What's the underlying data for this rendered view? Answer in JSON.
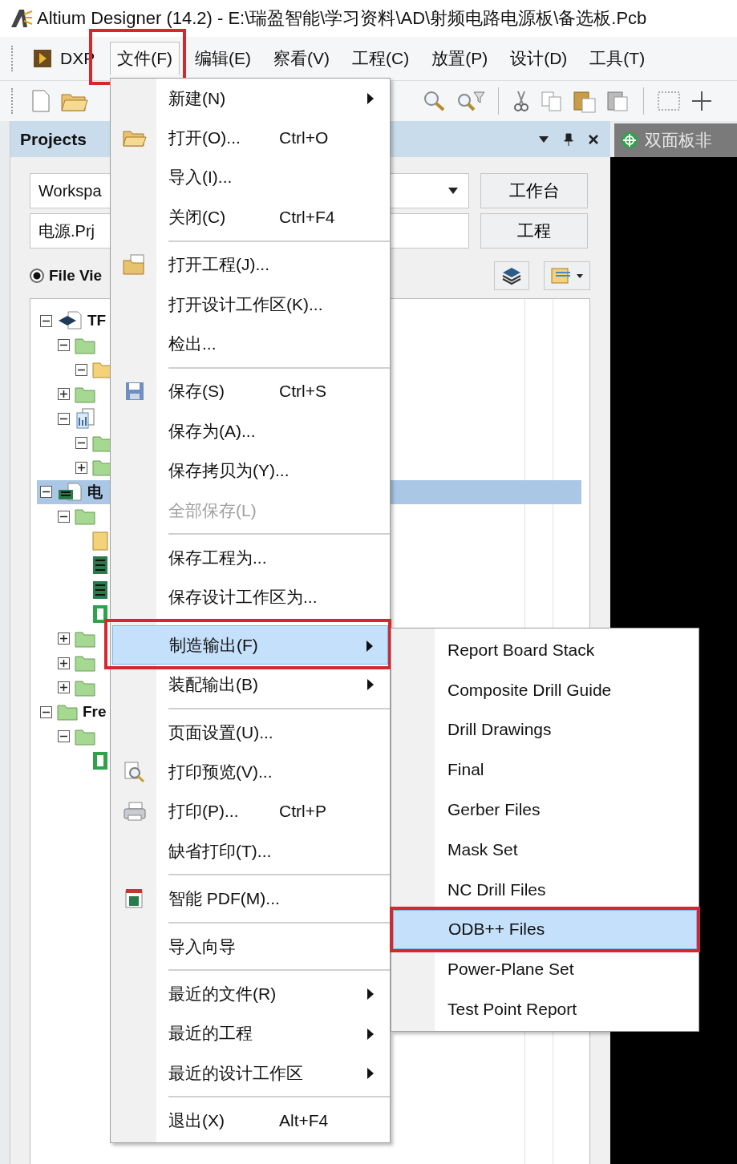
{
  "window": {
    "title": "Altium Designer (14.2) - E:\\瑞盈智能\\学习资料\\AD\\射频电路电源板\\备选板.Pcb"
  },
  "menu_bar": [
    {
      "label": "DXP",
      "selected": false,
      "annotated": false
    },
    {
      "label": "文件(F)",
      "selected": true,
      "annotated": true
    },
    {
      "label": "编辑(E)",
      "selected": false,
      "annotated": false
    },
    {
      "label": "察看(V)",
      "selected": false,
      "annotated": false
    },
    {
      "label": "工程(C)",
      "selected": false,
      "annotated": false
    },
    {
      "label": "放置(P)",
      "selected": false,
      "annotated": false
    },
    {
      "label": "设计(D)",
      "selected": false,
      "annotated": false
    },
    {
      "label": "工具(T)",
      "selected": false,
      "annotated": false
    }
  ],
  "projects_panel": {
    "title": "Projects",
    "workspace_field": {
      "value": "Workspa"
    },
    "workspace_button": "工作台",
    "project_field": {
      "value": "电源.Prj"
    },
    "project_button": "工程",
    "view_option": {
      "label": "File Vie",
      "selected": true
    },
    "tree": [
      {
        "label": "TF",
        "kind": "project",
        "expanded": true,
        "selected": false,
        "children": [
          {
            "kind": "folder",
            "expanded": true,
            "selected": false,
            "children": [
              {
                "kind": "yellow-folder",
                "expanded": true,
                "selected": false
              }
            ]
          },
          {
            "kind": "folder",
            "expanded": false,
            "selected": false
          },
          {
            "kind": "documents",
            "expanded": true,
            "selected": false,
            "children": [
              {
                "kind": "folder",
                "expanded": true,
                "selected": false
              },
              {
                "kind": "folder",
                "expanded": false,
                "selected": false
              }
            ]
          }
        ]
      },
      {
        "label": "电",
        "kind": "pcb-project",
        "expanded": true,
        "selected": true,
        "children": [
          {
            "kind": "folder",
            "expanded": true,
            "selected": false,
            "children": [
              {
                "kind": "sheet",
                "selected": false
              },
              {
                "kind": "board",
                "selected": false
              },
              {
                "kind": "board",
                "selected": false
              },
              {
                "kind": "schematic",
                "selected": false
              }
            ]
          },
          {
            "kind": "folder",
            "expanded": false,
            "selected": false
          },
          {
            "kind": "folder",
            "expanded": false,
            "selected": false
          },
          {
            "kind": "folder",
            "expanded": false,
            "selected": false
          }
        ]
      },
      {
        "label": "Fre",
        "kind": "folder",
        "expanded": true,
        "selected": false,
        "children": [
          {
            "kind": "folder",
            "expanded": true,
            "selected": false,
            "children": [
              {
                "kind": "schematic",
                "selected": false
              }
            ]
          }
        ]
      }
    ]
  },
  "document_tab": {
    "label": "双面板非"
  },
  "file_menu": {
    "items": [
      {
        "kind": "item",
        "label": "新建(N)",
        "has_submenu": true,
        "disabled": false,
        "selected": false,
        "annotated": false
      },
      {
        "kind": "item",
        "label": "打开(O)...",
        "shortcut": "Ctrl+O",
        "has_submenu": false,
        "disabled": false,
        "selected": false,
        "annotated": false
      },
      {
        "kind": "item",
        "label": "导入(I)...",
        "has_submenu": false,
        "disabled": false,
        "selected": false,
        "annotated": false
      },
      {
        "kind": "item",
        "label": "关闭(C)",
        "shortcut": "Ctrl+F4",
        "has_submenu": false,
        "disabled": false,
        "selected": false,
        "annotated": false
      },
      {
        "kind": "separator"
      },
      {
        "kind": "item",
        "label": "打开工程(J)...",
        "has_submenu": false,
        "disabled": false,
        "selected": false,
        "annotated": false
      },
      {
        "kind": "item",
        "label": "打开设计工作区(K)...",
        "has_submenu": false,
        "disabled": false,
        "selected": false,
        "annotated": false
      },
      {
        "kind": "item",
        "label": "检出...",
        "has_submenu": false,
        "disabled": false,
        "selected": false,
        "annotated": false
      },
      {
        "kind": "separator"
      },
      {
        "kind": "item",
        "label": "保存(S)",
        "shortcut": "Ctrl+S",
        "has_submenu": false,
        "disabled": false,
        "selected": false,
        "annotated": false
      },
      {
        "kind": "item",
        "label": "保存为(A)...",
        "has_submenu": false,
        "disabled": false,
        "selected": false,
        "annotated": false
      },
      {
        "kind": "item",
        "label": "保存拷贝为(Y)...",
        "has_submenu": false,
        "disabled": false,
        "selected": false,
        "annotated": false
      },
      {
        "kind": "item",
        "label": "全部保存(L)",
        "has_submenu": false,
        "disabled": true,
        "selected": false,
        "annotated": false
      },
      {
        "kind": "separator"
      },
      {
        "kind": "item",
        "label": "保存工程为...",
        "has_submenu": false,
        "disabled": false,
        "selected": false,
        "annotated": false
      },
      {
        "kind": "item",
        "label": "保存设计工作区为...",
        "has_submenu": false,
        "disabled": false,
        "selected": false,
        "annotated": false
      },
      {
        "kind": "separator"
      },
      {
        "kind": "item",
        "label": "制造输出(F)",
        "has_submenu": true,
        "disabled": false,
        "selected": true,
        "annotated": true
      },
      {
        "kind": "item",
        "label": "装配输出(B)",
        "has_submenu": true,
        "disabled": false,
        "selected": false,
        "annotated": false
      },
      {
        "kind": "separator"
      },
      {
        "kind": "item",
        "label": "页面设置(U)...",
        "has_submenu": false,
        "disabled": false,
        "selected": false,
        "annotated": false
      },
      {
        "kind": "item",
        "label": "打印预览(V)...",
        "has_submenu": false,
        "disabled": false,
        "selected": false,
        "annotated": false
      },
      {
        "kind": "item",
        "label": "打印(P)...",
        "shortcut": "Ctrl+P",
        "has_submenu": false,
        "disabled": false,
        "selected": false,
        "annotated": false
      },
      {
        "kind": "item",
        "label": "缺省打印(T)...",
        "has_submenu": false,
        "disabled": false,
        "selected": false,
        "annotated": false
      },
      {
        "kind": "separator"
      },
      {
        "kind": "item",
        "label": "智能 PDF(M)...",
        "has_submenu": false,
        "disabled": false,
        "selected": false,
        "annotated": false
      },
      {
        "kind": "separator"
      },
      {
        "kind": "item",
        "label": "导入向导",
        "has_submenu": false,
        "disabled": false,
        "selected": false,
        "annotated": false
      },
      {
        "kind": "separator"
      },
      {
        "kind": "item",
        "label": "最近的文件(R)",
        "has_submenu": true,
        "disabled": false,
        "selected": false,
        "annotated": false
      },
      {
        "kind": "item",
        "label": "最近的工程",
        "has_submenu": true,
        "disabled": false,
        "selected": false,
        "annotated": false
      },
      {
        "kind": "item",
        "label": "最近的设计工作区",
        "has_submenu": true,
        "disabled": false,
        "selected": false,
        "annotated": false
      },
      {
        "kind": "separator"
      },
      {
        "kind": "item",
        "label": "退出(X)",
        "shortcut": "Alt+F4",
        "has_submenu": false,
        "disabled": false,
        "selected": false,
        "annotated": false
      }
    ]
  },
  "fabrication_submenu": {
    "items": [
      {
        "label": "Report Board Stack",
        "selected": false,
        "annotated": false
      },
      {
        "label": "Composite Drill Guide",
        "selected": false,
        "annotated": false
      },
      {
        "label": "Drill Drawings",
        "selected": false,
        "annotated": false
      },
      {
        "label": "Final",
        "selected": false,
        "annotated": false
      },
      {
        "label": "Gerber Files",
        "selected": false,
        "annotated": false
      },
      {
        "label": "Mask Set",
        "selected": false,
        "annotated": false
      },
      {
        "label": "NC Drill Files",
        "selected": false,
        "annotated": false
      },
      {
        "label": "ODB++ Files",
        "selected": true,
        "annotated": true
      },
      {
        "label": "Power-Plane Set",
        "selected": false,
        "annotated": false
      },
      {
        "label": "Test Point Report",
        "selected": false,
        "annotated": false
      }
    ]
  }
}
